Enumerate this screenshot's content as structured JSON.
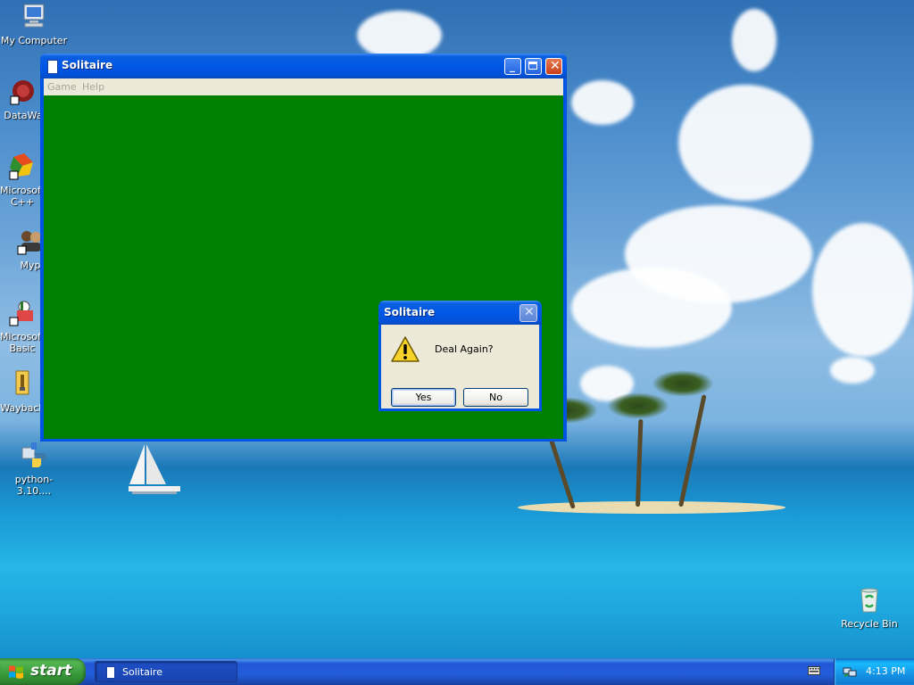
{
  "desktop": {
    "icons": [
      {
        "label": "My Computer"
      },
      {
        "label": "DataWa"
      },
      {
        "label": "Microsoft C++"
      },
      {
        "label": "Myp"
      },
      {
        "label": "Microsoft Basic"
      },
      {
        "label": "Wayback"
      },
      {
        "label": "python-3.10...."
      },
      {
        "label": "Recycle Bin"
      }
    ]
  },
  "window": {
    "title": "Solitaire",
    "icon": "card-icon",
    "menu": [
      "Game",
      "Help"
    ],
    "controls": {
      "minimize": "minimize-icon",
      "maximize": "maximize-icon",
      "close": "close-icon"
    },
    "felt_color": "#007f00"
  },
  "dialog": {
    "title": "Solitaire",
    "icon": "warning-icon",
    "message": "Deal Again?",
    "yes_label": "Yes",
    "no_label": "No"
  },
  "taskbar": {
    "start_label": "start",
    "tasks": [
      {
        "label": "Solitaire",
        "icon": "card-icon"
      }
    ],
    "clock": "4:13 PM"
  },
  "colors": {
    "titlebar": "#0058e6",
    "taskbar": "#245edb",
    "start_button": "#389838",
    "dialog_face": "#ece9d8"
  }
}
